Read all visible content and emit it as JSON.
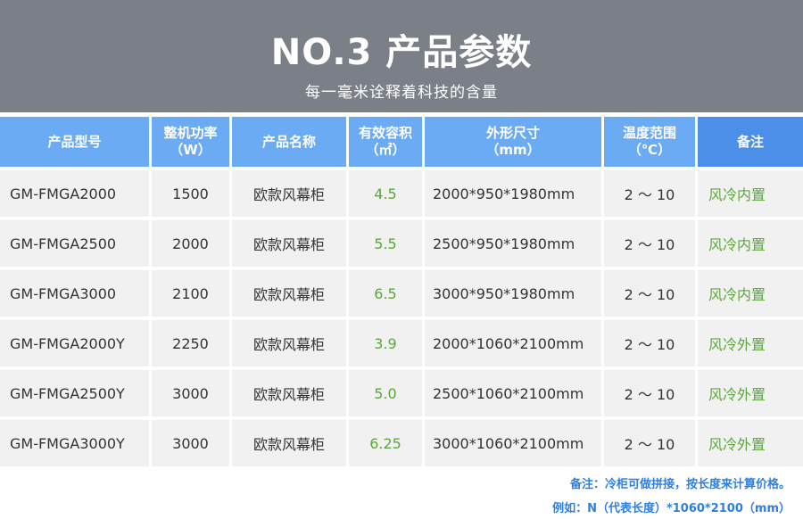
{
  "banner": {
    "title": "NO.3 产品参数",
    "subtitle": "每一毫米诠释着科技的含量"
  },
  "table": {
    "headers": [
      {
        "line1": "产品型号",
        "line2": ""
      },
      {
        "line1": "整机功率",
        "line2": "（W）"
      },
      {
        "line1": "产品名称",
        "line2": ""
      },
      {
        "line1": "有效容积",
        "line2": "（㎡）"
      },
      {
        "line1": "外形尺寸",
        "line2": "（mm）"
      },
      {
        "line1": "温度范围",
        "line2": "（℃）"
      },
      {
        "line1": "备注",
        "line2": ""
      }
    ],
    "rows": [
      {
        "model": "GM-FMGA2000",
        "power": "1500",
        "name": "欧款风幕柜",
        "volume": "4.5",
        "size": "2000*950*1980mm",
        "temp": "2 ～ 10",
        "note": "风冷内置"
      },
      {
        "model": "GM-FMGA2500",
        "power": "2000",
        "name": "欧款风幕柜",
        "volume": "5.5",
        "size": "2500*950*1980mm",
        "temp": "2 ～ 10",
        "note": "风冷内置"
      },
      {
        "model": "GM-FMGA3000",
        "power": "2100",
        "name": "欧款风幕柜",
        "volume": "6.5",
        "size": "3000*950*1980mm",
        "temp": "2 ～ 10",
        "note": "风冷内置"
      },
      {
        "model": "GM-FMGA2000Y",
        "power": "2250",
        "name": "欧款风幕柜",
        "volume": "3.9",
        "size": "2000*1060*2100mm",
        "temp": "2 ～ 10",
        "note": "风冷外置"
      },
      {
        "model": "GM-FMGA2500Y",
        "power": "3000",
        "name": "欧款风幕柜",
        "volume": "5.0",
        "size": "2500*1060*2100mm",
        "temp": "2 ～ 10",
        "note": "风冷外置"
      },
      {
        "model": "GM-FMGA3000Y",
        "power": "3000",
        "name": "欧款风幕柜",
        "volume": "6.25",
        "size": "3000*1060*2100mm",
        "temp": "2 ～ 10",
        "note": "风冷外置"
      }
    ]
  },
  "footnote": {
    "line1": "备注：冷柜可做拼接，按长度来计算价格。",
    "line2": "例如：N（代表长度）*1060*2100（mm）"
  },
  "colors": {
    "banner_bg": "#7b8088",
    "header_bg": "#6aabf4",
    "header_note_bg": "#4b8fe8",
    "row_bg": "#f1f1f1",
    "green_text": "#5aa83a",
    "footnote_blue": "#2f7fe0"
  }
}
